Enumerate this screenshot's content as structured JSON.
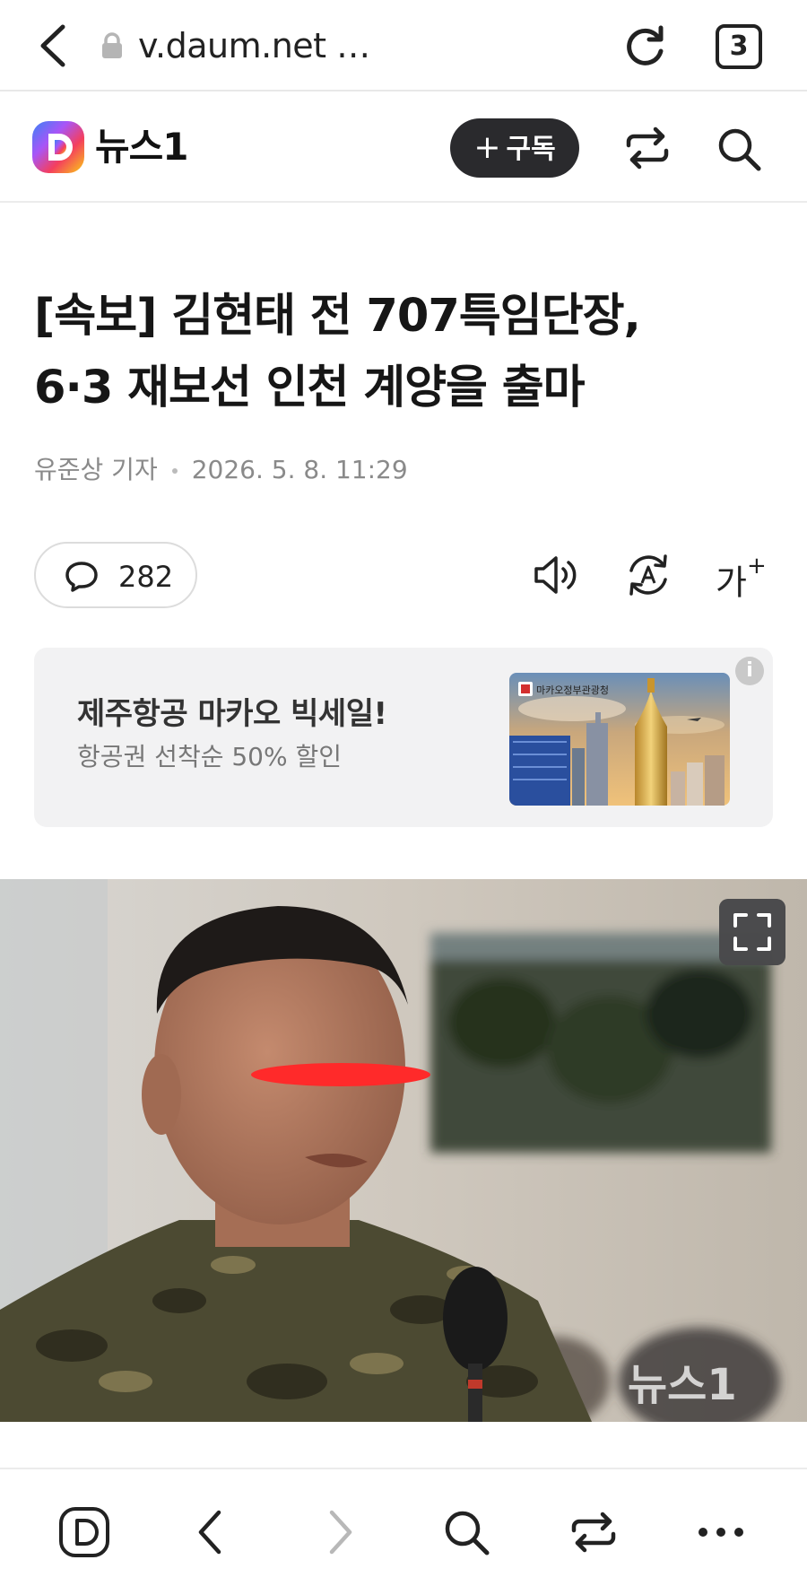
{
  "browser": {
    "url": "v.daum.net …",
    "tab_count": "3",
    "icons": [
      "back-icon",
      "lock-icon",
      "refresh-icon",
      "tabs-icon"
    ]
  },
  "header": {
    "logo_letter": "D",
    "title": "뉴스1",
    "subscribe_plus": "+",
    "subscribe_label": "구독",
    "icons": [
      "share-icon",
      "search-icon"
    ]
  },
  "article": {
    "headline_line1": "[속보] 김현태 전 707특임단장,",
    "headline_line2": "6·3 재보선 인천 계양을 출마",
    "reporter": "유준상 기자",
    "datetime": "2026. 5. 8. 11:29",
    "comment_count": "282",
    "font_size_label": "가",
    "font_size_plus": "+",
    "tool_icons": [
      "speaker-icon",
      "translate-icon",
      "font-size-icon"
    ]
  },
  "ad": {
    "title": "제주항공 마카오 빅세일!",
    "subtitle": "항공권 선착순 50% 할인",
    "image_caption": "마카오정부관광청",
    "info": "i"
  },
  "photo": {
    "watermark": "뉴스1",
    "expand_icon": "expand-icon"
  },
  "colors": {
    "subscribe_bg": "#2a2a2d",
    "ad_bg": "#f2f2f3",
    "byline": "#8a8a8a",
    "redaction": "#ff2a2a"
  },
  "bottom_nav": {
    "items": [
      "daum-home-icon",
      "back-icon",
      "forward-icon",
      "search-icon",
      "share-icon",
      "more-icon"
    ]
  }
}
